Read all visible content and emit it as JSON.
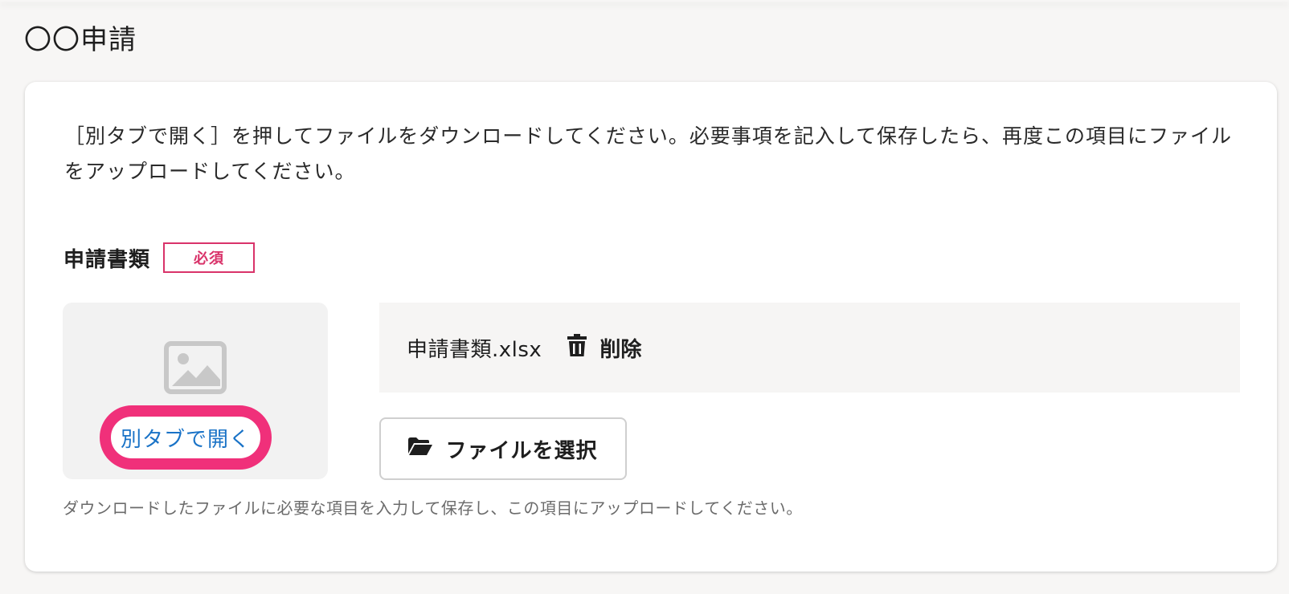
{
  "page": {
    "title": "〇〇申請"
  },
  "card": {
    "instruction": "［別タブで開く］を押してファイルをダウンロードしてください。必要事項を記入して保存したら、再度この項目にファイルをアップロードしてください。",
    "field": {
      "label": "申請書類",
      "required_badge": "必須",
      "preview": {
        "icon": "image-placeholder-icon",
        "open_link": "別タブで開く"
      },
      "file": {
        "name": "申請書類.xlsx",
        "delete_icon": "trash-icon",
        "delete_label": "削除"
      },
      "select_button": {
        "icon": "folder-open-icon",
        "label": "ファイルを選択"
      },
      "help_text": "ダウンロードしたファイルに必要な項目を入力して保存し、この項目にアップロードしてください。"
    }
  },
  "colors": {
    "required": "#d9336a",
    "link": "#1a73c7",
    "highlight_ring": "#f0307a"
  }
}
